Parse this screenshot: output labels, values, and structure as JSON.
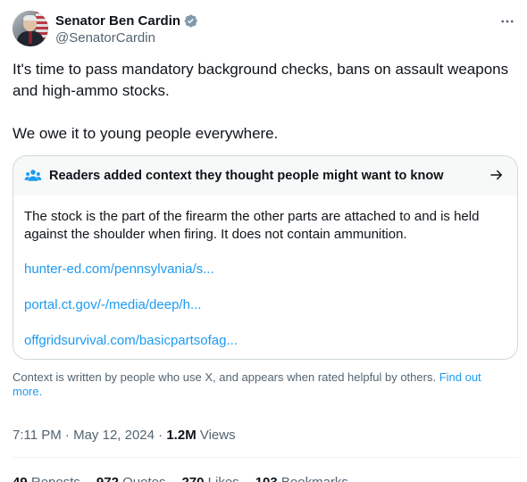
{
  "author": {
    "display_name": "Senator Ben Cardin",
    "handle": "@SenatorCardin",
    "verified_icon": "verified-badge-icon"
  },
  "tweet": {
    "paragraphs": [
      "It's time to pass mandatory background checks, bans on assault weapons and high-ammo stocks.",
      "We owe it to young people everywhere."
    ]
  },
  "community_note": {
    "title": "Readers added context they thought people might want to know",
    "body": "The stock is the part of the firearm the other parts are attached to and is held against the shoulder when firing. It does not contain ammunition.",
    "links": [
      "hunter-ed.com/pennsylvania/s...",
      "portal.ct.gov/-/media/deep/h...",
      "offgridsurvival.com/basicpartsofag..."
    ]
  },
  "disclaimer": {
    "text": "Context is written by people who use X, and appears when rated helpful by others. ",
    "link": "Find out more."
  },
  "meta": {
    "time": "7:11 PM",
    "separator": " · ",
    "date": "May 12, 2024",
    "views_count": "1.2M",
    "views_label": " Views"
  },
  "stats": [
    {
      "count": "49",
      "label": "Reposts"
    },
    {
      "count": "972",
      "label": "Quotes"
    },
    {
      "count": "270",
      "label": "Likes"
    },
    {
      "count": "103",
      "label": "Bookmarks"
    }
  ],
  "colors": {
    "link": "#1d9bf0",
    "secondary_text": "#536471",
    "primary_text": "#0f1419",
    "note_header_bg": "#f7f9f9",
    "border": "#cfd9de"
  }
}
